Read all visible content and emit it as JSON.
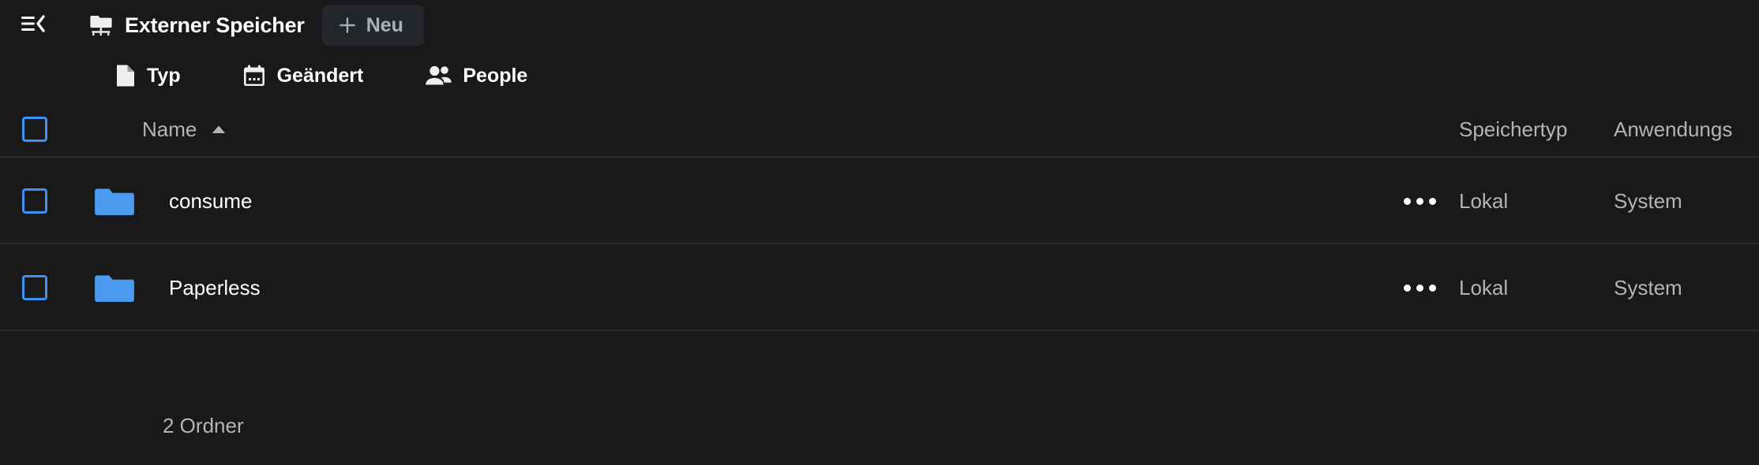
{
  "colors": {
    "background": "#191919",
    "row_divider": "#2c2c2e",
    "accent_blue": "#3b90f2",
    "folder_blue": "#4a9bf0",
    "muted_text": "#b4b4b4",
    "new_button_bg": "#23272c",
    "new_button_text": "#a8b0b8"
  },
  "topbar": {
    "menu_icon": "collapse-sidebar-icon",
    "title_icon": "network-folder-icon",
    "title": "Externer Speicher",
    "new_button": {
      "icon": "plus-icon",
      "label": "Neu"
    }
  },
  "filters": [
    {
      "icon": "file-icon",
      "label": "Typ"
    },
    {
      "icon": "calendar-icon",
      "label": "Geändert"
    },
    {
      "icon": "people-icon",
      "label": "People"
    }
  ],
  "table": {
    "header": {
      "select_all_checkbox": "unchecked",
      "name_label": "Name",
      "sort_indicator": "ascending-caret-up-icon",
      "storage_label": "Speichertyp",
      "app_label": "Anwendungs"
    },
    "rows": [
      {
        "checkbox": "unchecked",
        "icon": "folder-icon",
        "name": "consume",
        "more_menu": "overflow-menu-icon",
        "storage": "Lokal",
        "app": "System"
      },
      {
        "checkbox": "unchecked",
        "icon": "folder-icon",
        "name": "Paperless",
        "more_menu": "overflow-menu-icon",
        "storage": "Lokal",
        "app": "System"
      }
    ]
  },
  "footer": {
    "count_label": "2 Ordner"
  }
}
